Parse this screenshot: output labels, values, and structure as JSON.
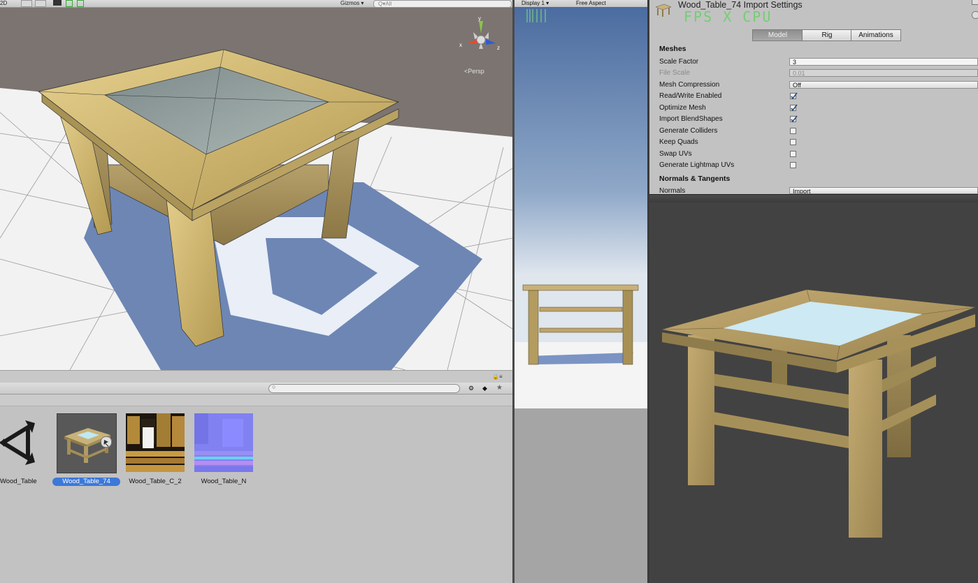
{
  "scene": {
    "toolbar": {
      "mode_2d": "2D",
      "gizmos_label": "Gizmos",
      "search_placeholder": "Q▾All"
    },
    "gizmo": {
      "axis_y": "y",
      "axis_x": "x",
      "axis_z": "z",
      "projection": "Persp"
    }
  },
  "game": {
    "display": "Display 1",
    "aspect": "Free Aspect"
  },
  "project": {
    "assets": [
      {
        "label": "Wood_Table",
        "type": "unity-model"
      },
      {
        "label": "Wood_Table_74",
        "type": "mesh",
        "selected": true
      },
      {
        "label": "Wood_Table_C_2",
        "type": "texture"
      },
      {
        "label": "Wood_Table_N",
        "type": "normal-map"
      }
    ]
  },
  "inspector": {
    "title": "Wood_Table_74 Import Settings",
    "overlay": "FPS X CPU",
    "tabs": [
      {
        "label": "Model",
        "active": true
      },
      {
        "label": "Rig",
        "active": false
      },
      {
        "label": "Animations",
        "active": false
      }
    ],
    "meshes_header": "Meshes",
    "scale_factor": {
      "label": "Scale Factor",
      "value": "3"
    },
    "file_scale": {
      "label": "File Scale",
      "value": "0.01"
    },
    "mesh_compression": {
      "label": "Mesh Compression",
      "value": "Off"
    },
    "checkboxes": [
      {
        "label": "Read/Write Enabled",
        "checked": true
      },
      {
        "label": "Optimize Mesh",
        "checked": true
      },
      {
        "label": "Import BlendShapes",
        "checked": true
      },
      {
        "label": "Generate Colliders",
        "checked": false
      },
      {
        "label": "Keep Quads",
        "checked": false
      },
      {
        "label": "Swap UVs",
        "checked": false
      },
      {
        "label": "Generate Lightmap UVs",
        "checked": false
      }
    ],
    "normals_header": "Normals & Tangents",
    "normals": {
      "label": "Normals",
      "value": "Import"
    }
  }
}
